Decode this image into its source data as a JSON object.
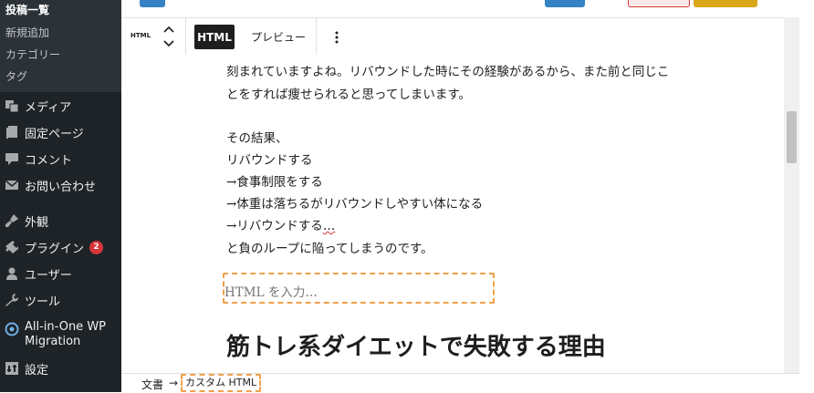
{
  "sidebar": {
    "submenu": {
      "current": "投稿一覧",
      "items": [
        "新規追加",
        "カテゴリー",
        "タグ"
      ]
    },
    "menu": [
      {
        "label": "メディア",
        "icon": "media-icon"
      },
      {
        "label": "固定ページ",
        "icon": "page-icon"
      },
      {
        "label": "コメント",
        "icon": "comment-icon"
      },
      {
        "label": "お問い合わせ",
        "icon": "mail-icon"
      },
      {
        "label": "外観",
        "icon": "appearance-icon"
      },
      {
        "label": "プラグイン",
        "icon": "plugin-icon",
        "badge": "2"
      },
      {
        "label": "ユーザー",
        "icon": "user-icon"
      },
      {
        "label": "ツール",
        "icon": "tool-icon"
      },
      {
        "label_line1": "All-in-One WP",
        "label_line2": "Migration",
        "icon": "migration-icon"
      },
      {
        "label": "設定",
        "icon": "settings-icon"
      }
    ]
  },
  "toolbar": {
    "block_type": "HTML",
    "html_tab": "HTML",
    "preview_tab": "プレビュー"
  },
  "content": {
    "paragraph1": [
      "刻まれていますよね。リバウンドした時にその経験があるから、また前と同じこ",
      "とをすれば痩せられると思ってしまいます。"
    ],
    "paragraph2": [
      "その結果、",
      "リバウンドする",
      "→食事制限をする",
      "→体重は落ちるがリバウンドしやすい体になる",
      "→リバウンドする",
      "と負のループに陥ってしまうのです。"
    ],
    "ellipsis": "…",
    "html_placeholder": "HTML を入力…",
    "heading": "筋トレ系ダイエットで失敗する理由"
  },
  "breadcrumb": {
    "root": "文書",
    "arrow": "→",
    "current": "カスタム HTML"
  },
  "colors": {
    "sidebar_bg": "#1d2327",
    "submenu_bg": "#2c3338",
    "badge": "#d63638",
    "focus_outline": "#f0a04b",
    "primary_button": "#3582c4"
  }
}
